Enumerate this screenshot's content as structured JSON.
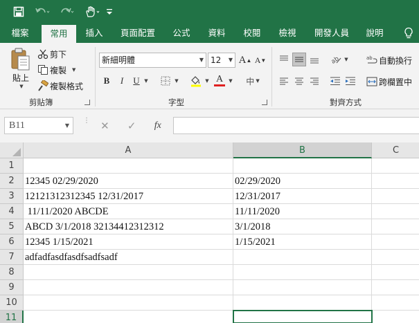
{
  "quick_access": {
    "save_icon": "save-icon",
    "undo_icon": "undo-icon",
    "redo_icon": "redo-icon",
    "touch_icon": "touch-mode-icon",
    "customize_icon": "customize-icon"
  },
  "tabs": [
    "檔案",
    "常用",
    "插入",
    "頁面配置",
    "公式",
    "資料",
    "校閱",
    "檢視",
    "開發人員",
    "說明"
  ],
  "active_tab": "常用",
  "ribbon": {
    "clipboard": {
      "paste": "貼上",
      "cut": "剪下",
      "copy": "複製",
      "format_painter": "複製格式",
      "label": "剪貼簿"
    },
    "font": {
      "family": "新細明體",
      "size": "12",
      "bold": "B",
      "italic": "I",
      "underline": "U",
      "grow": "A",
      "shrink": "A",
      "font_color": "A",
      "phonetic": "中",
      "label": "字型"
    },
    "alignment": {
      "wrap_text": "自動換行",
      "merge_center": "跨欄置中",
      "label": "對齊方式"
    }
  },
  "formula_bar": {
    "name_box": "B11",
    "fx": "fx",
    "value": ""
  },
  "grid": {
    "columns": [
      "A",
      "B",
      "C"
    ],
    "rows": [
      "1",
      "2",
      "3",
      "4",
      "5",
      "6",
      "7",
      "8",
      "9",
      "10",
      "11"
    ],
    "cells": {
      "A2": "12345 02/29/2020",
      "B2": "02/29/2020",
      "A3": "12121312312345 12/31/2017",
      "B3": "12/31/2017",
      "A4": " 11/11/2020 ABCDE",
      "B4": "11/11/2020",
      "A5": "ABCD 3/1/2018 32134412312312",
      "B5": "3/1/2018",
      "A6": "12345 1/15/2021",
      "B6": "1/15/2021",
      "A7": "adfadfasdfasdfsadfsadf"
    },
    "selected_cell": "B11",
    "colors": {
      "accent": "#217346"
    }
  }
}
